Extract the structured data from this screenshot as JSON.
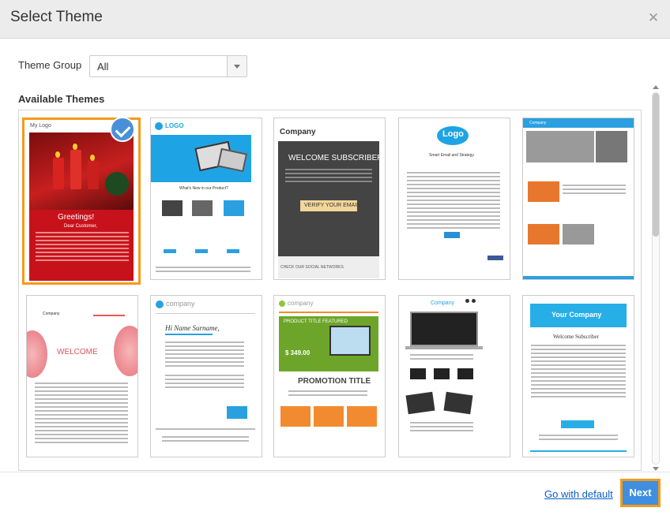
{
  "dialog": {
    "title": "Select Theme",
    "close_icon": "close-icon"
  },
  "theme_group": {
    "label": "Theme Group",
    "selected": "All"
  },
  "available_label": "Available Themes",
  "themes": [
    {
      "heading": "My Logo",
      "title": "Greetings!",
      "subtitle": "Dear Customer,",
      "selected": true
    },
    {
      "heading": "LOGO",
      "title": "What's New in our Product?"
    },
    {
      "heading": "Company",
      "title": "WELCOME SUBSCRIBER",
      "button": "VERIFY YOUR EMAIL",
      "footer": "CHECK OUR SOCIAL NETWORKS"
    },
    {
      "heading": "Logo",
      "title": "Smart Email and Strategy"
    },
    {
      "heading": "Company"
    },
    {
      "heading": "Company",
      "title": "WELCOME"
    },
    {
      "heading": "company",
      "title": "Hi Name Surname,"
    },
    {
      "heading": "company",
      "title": "PRODUCT TITLE FEATURED",
      "price": "$ 349.00",
      "promo": "PROMOTION TITLE"
    },
    {
      "heading": "Company"
    },
    {
      "heading": "Your Company",
      "title": "Welcome Subscriber"
    }
  ],
  "footer": {
    "default_link": "Go with default",
    "next_label": "Next"
  },
  "colors": {
    "accent": "#f39a1c",
    "primary": "#3f8ee0",
    "link": "#0b5fc5"
  }
}
